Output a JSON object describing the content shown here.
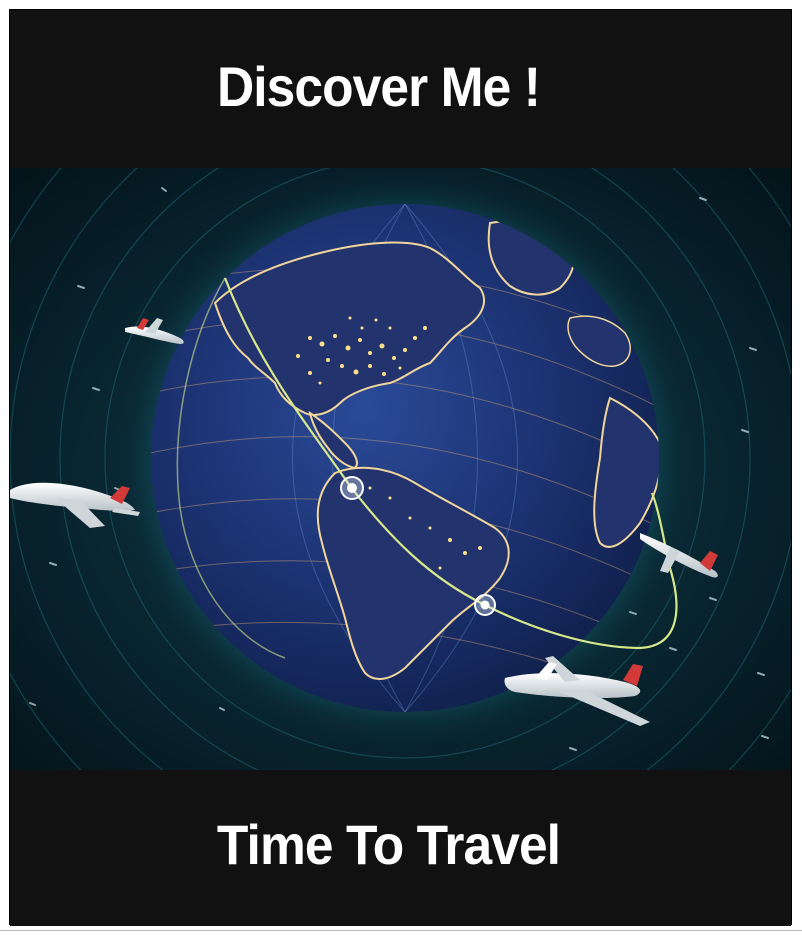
{
  "poster": {
    "title": "Discover Me !",
    "subtitle": "Time To Travel"
  },
  "illustration": {
    "subject": "globe with flight route and airliners",
    "colors": {
      "background": "#111111",
      "space": "#082530",
      "globe_ocean": "#1a2f6a",
      "globe_glow": "#2fb8c8",
      "city_lights": "#ffd77a",
      "route": "#d6e88a",
      "text": "#ffffff"
    },
    "icons": [
      "globe-icon",
      "airplane-icon",
      "route-marker-icon"
    ]
  }
}
